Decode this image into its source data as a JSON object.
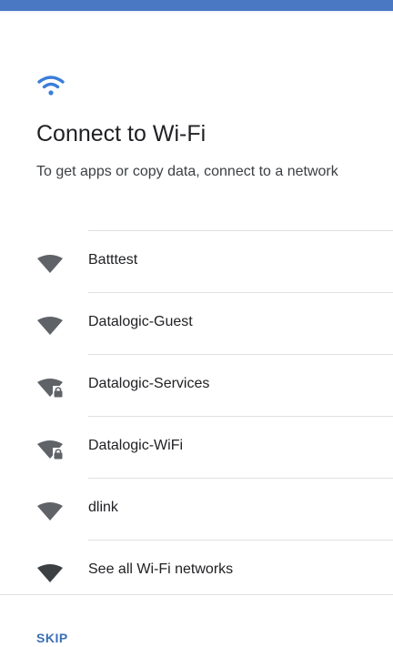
{
  "header": {
    "icon": "wifi-icon",
    "accent_color": "#4a78c2",
    "title": "Connect to Wi-Fi",
    "subtitle": "To get apps or copy data, connect to a network"
  },
  "networks": [
    {
      "name": "Batttest",
      "icon": "wifi-signal-icon",
      "secured": false
    },
    {
      "name": "Datalogic-Guest",
      "icon": "wifi-signal-icon",
      "secured": false
    },
    {
      "name": "Datalogic-Services",
      "icon": "wifi-lock-icon",
      "secured": true
    },
    {
      "name": "Datalogic-WiFi",
      "icon": "wifi-lock-icon",
      "secured": true
    },
    {
      "name": "dlink",
      "icon": "wifi-signal-icon",
      "secured": false
    },
    {
      "name": "See all Wi-Fi networks",
      "icon": "wifi-signal-icon",
      "secured": false
    }
  ],
  "footer": {
    "skip_label": "SKIP",
    "skip_color": "#3b6fb6"
  }
}
